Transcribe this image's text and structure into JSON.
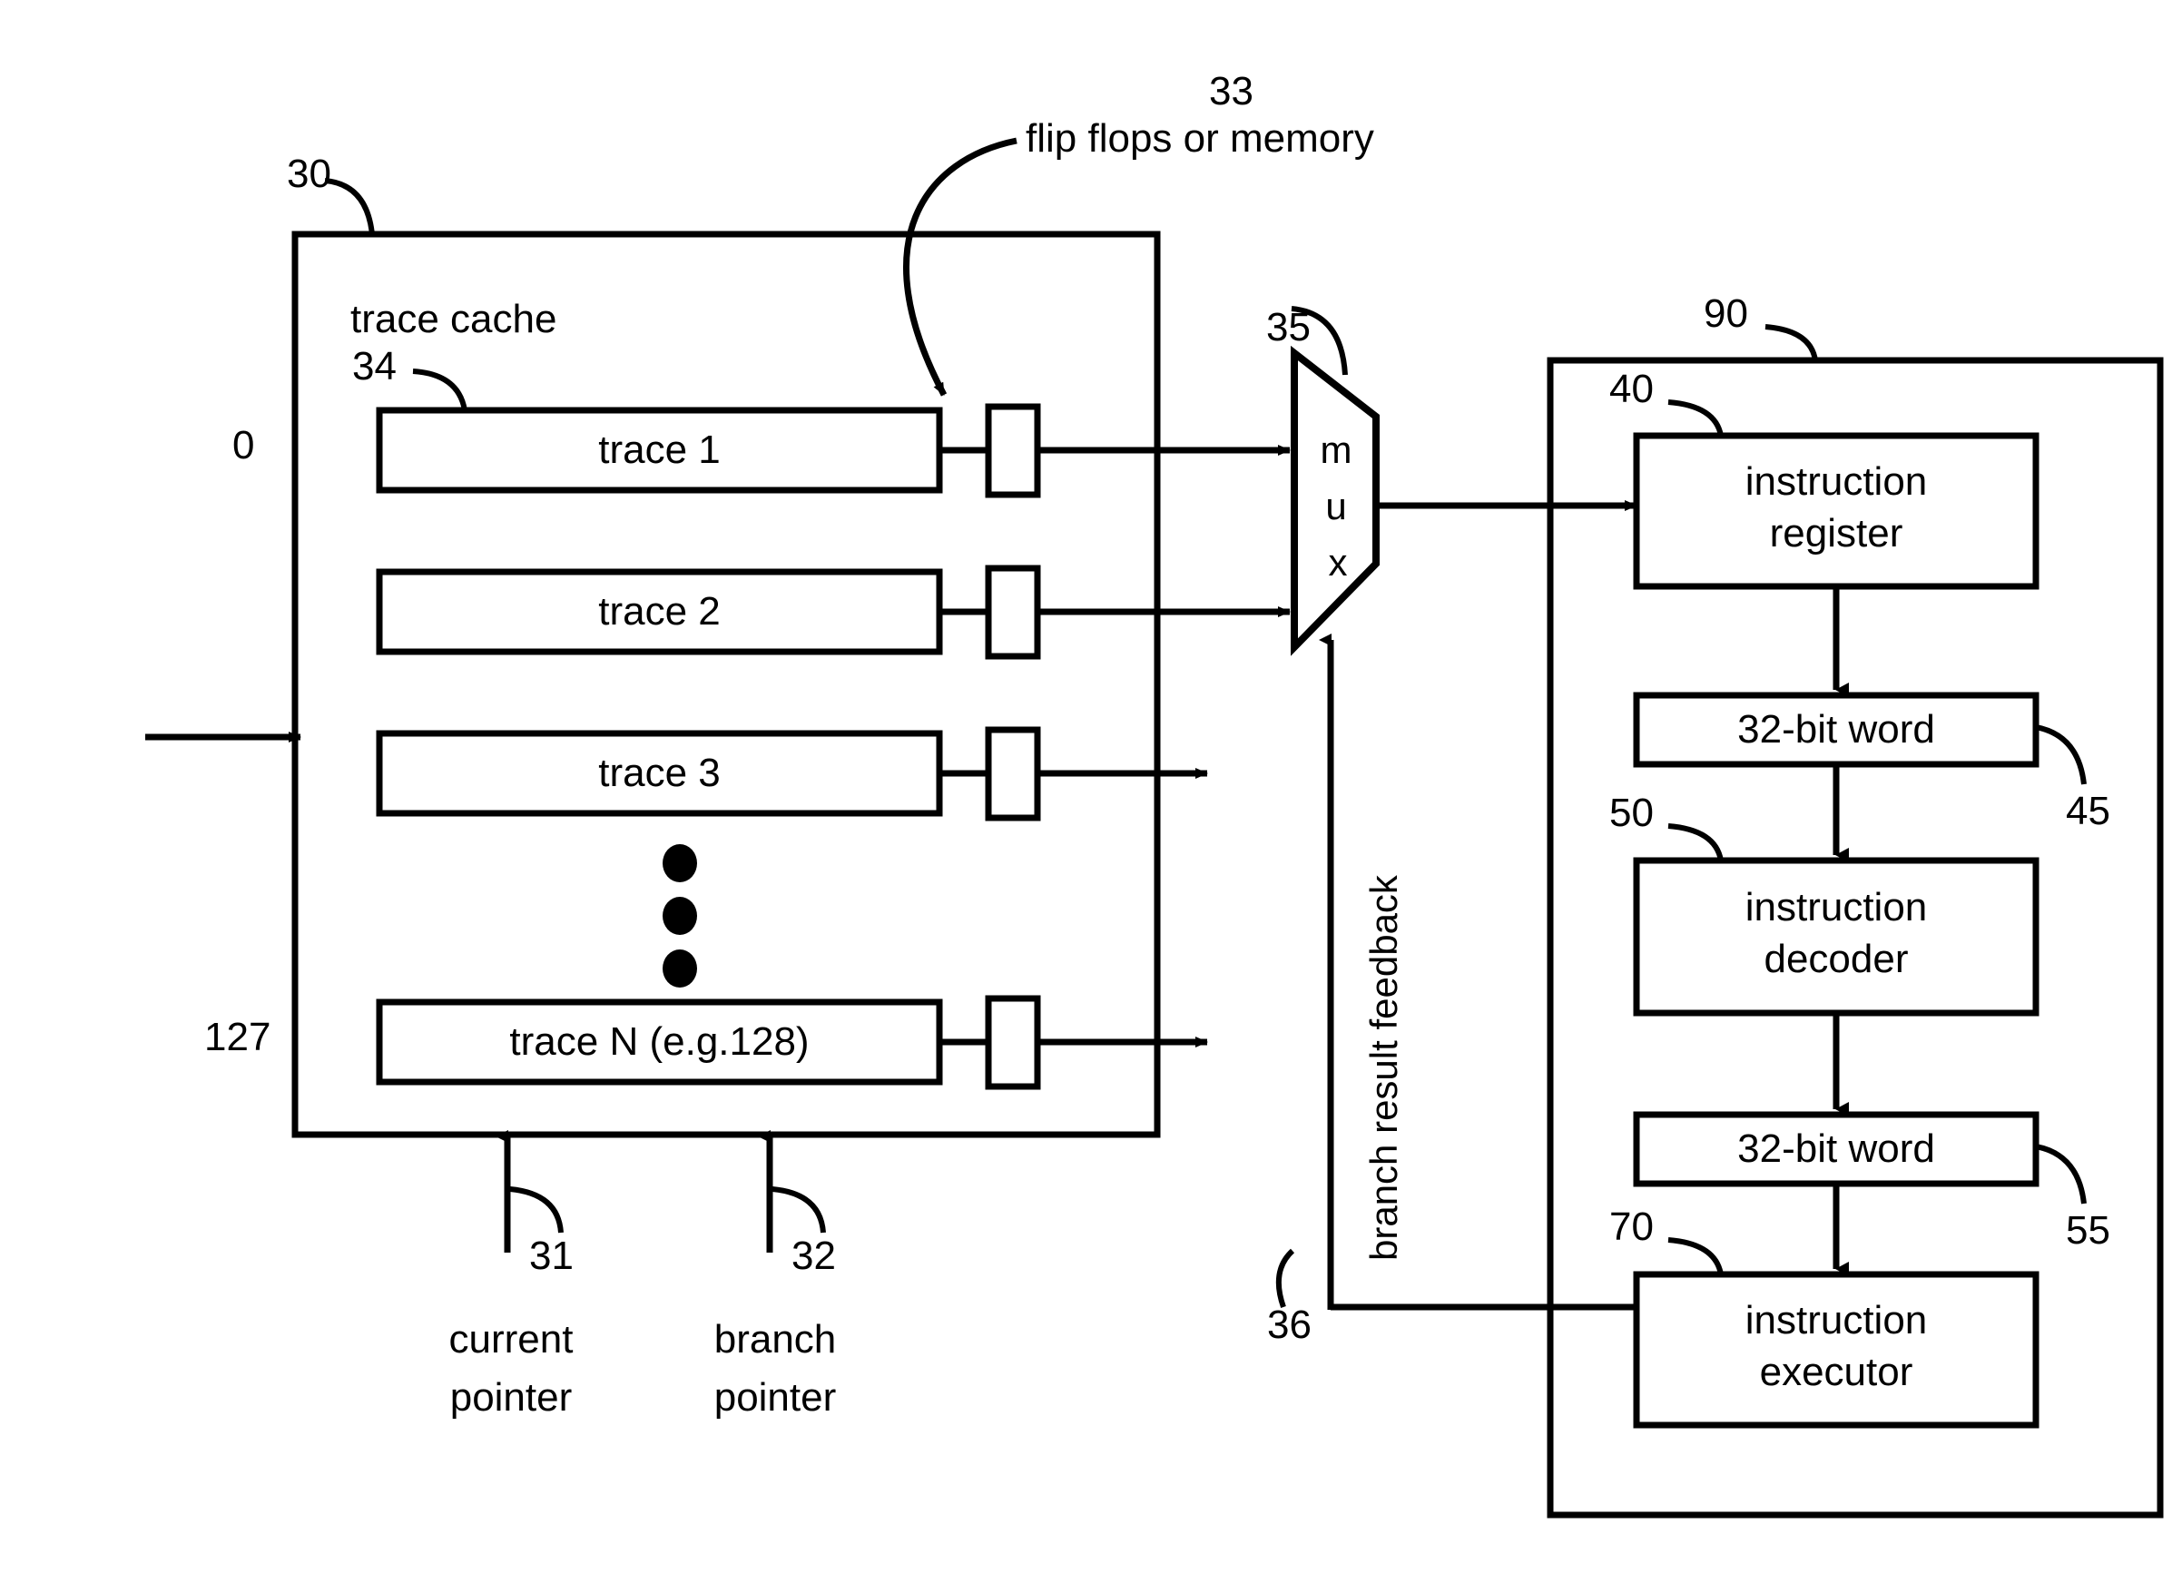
{
  "figure": {
    "title": "trace cache and instruction pipeline block diagram",
    "reference_numerals": {
      "trace_cache_block": "30",
      "current_pointer": "31",
      "branch_pointer": "32",
      "flip_flops": "33",
      "trace_entry": "34",
      "mux": "35",
      "branch_feedback": "36",
      "instruction_register": "40",
      "word_after_register": "45",
      "instruction_decoder": "50",
      "word_after_decoder": "55",
      "instruction_executor": "70",
      "processor_block": "90"
    }
  },
  "trace_cache": {
    "label": "trace cache",
    "ref": "30",
    "entry_ref": "34",
    "index_top": "0",
    "index_bottom": "127",
    "rows": [
      {
        "label": "trace 1"
      },
      {
        "label": "trace 2"
      },
      {
        "label": "trace 3"
      },
      {
        "label": "trace N (e.g.128)"
      }
    ],
    "ellipsis_dots": 3
  },
  "annotations": {
    "flip_flops": {
      "text": "flip flops or memory",
      "ref": "33"
    },
    "mux": {
      "text": "mux",
      "letters": [
        "m",
        "u",
        "x"
      ],
      "ref": "35"
    },
    "branch_feedback": {
      "text": "branch result feedback",
      "ref": "36"
    }
  },
  "pointers": [
    {
      "label_line1": "current",
      "label_line2": "pointer",
      "ref": "31"
    },
    {
      "label_line1": "branch",
      "label_line2": "pointer",
      "ref": "32"
    }
  ],
  "processor": {
    "ref": "90",
    "stages": [
      {
        "line1": "instruction",
        "line2": "register",
        "ref": "40",
        "ref_side": "left"
      },
      {
        "line1": "32-bit word",
        "line2": "",
        "ref": "45",
        "ref_side": "right"
      },
      {
        "line1": "instruction",
        "line2": "decoder",
        "ref": "50",
        "ref_side": "left"
      },
      {
        "line1": "32-bit word",
        "line2": "",
        "ref": "55",
        "ref_side": "right"
      },
      {
        "line1": "instruction",
        "line2": "executor",
        "ref": "70",
        "ref_side": "left"
      }
    ]
  },
  "colors": {
    "ink": "#000000",
    "paper": "#ffffff"
  }
}
